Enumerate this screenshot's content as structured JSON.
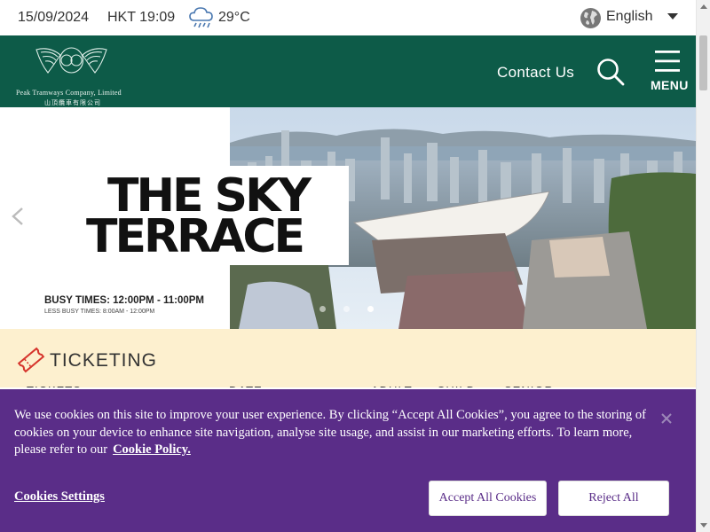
{
  "topbar": {
    "date": "15/09/2024",
    "time": "HKT 19:09",
    "weather_icon": "rain-cloud-icon",
    "temperature": "29°C",
    "language": "English"
  },
  "header": {
    "logo_name": "Peak Tramways Company, Limited",
    "logo_name_cn": "山頂纜車有限公司",
    "contact_label": "Contact Us",
    "menu_label": "MENU",
    "bg_color": "#0d5b48"
  },
  "hero": {
    "title_line1": "THE SKY",
    "title_line2": "TERRACE",
    "busy_times": "BUSY TIMES: 12:00PM - 11:00PM",
    "less_busy_times": "LESS BUSY TIMES: 8:00AM - 12:00PM",
    "slide_count": 3,
    "active_slide": 3
  },
  "ticketing": {
    "title": "TICKETING",
    "columns": [
      "TICKETS",
      "DATE",
      "ADULT",
      "CHILD",
      "SENIOR"
    ],
    "bg_color": "#fdf0cf"
  },
  "cookie_banner": {
    "text": "We use cookies on this site to improve your user experience. By clicking “Accept All Cookies”, you agree to the storing of cookies on your device to enhance site navigation, analyse site usage, and assist in our marketing efforts. To learn more, please refer to our",
    "policy_link": "Cookie Policy.",
    "settings_label": "Cookies Settings",
    "accept_label": "Accept All Cookies",
    "reject_label": "Reject All",
    "bg_color": "#5a2d88"
  }
}
